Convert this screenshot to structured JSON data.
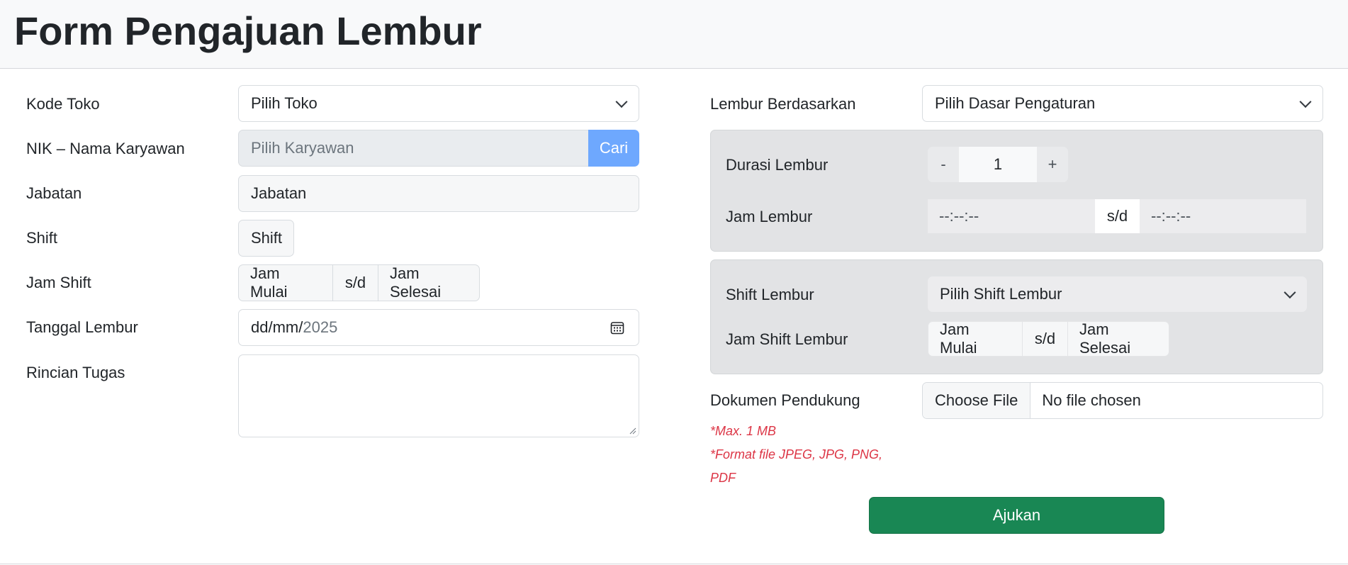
{
  "header": {
    "title": "Form Pengajuan Lembur"
  },
  "left": {
    "kode_toko": {
      "label": "Kode Toko",
      "value": "Pilih Toko"
    },
    "nik": {
      "label": "NIK – Nama Karyawan",
      "placeholder": "Pilih Karyawan",
      "button": "Cari"
    },
    "jabatan": {
      "label": "Jabatan",
      "value": "Jabatan"
    },
    "shift": {
      "label": "Shift",
      "value": "Shift"
    },
    "jam_shift": {
      "label": "Jam Shift",
      "start": "Jam Mulai",
      "sep": "s/d",
      "end": "Jam Selesai"
    },
    "tanggal": {
      "label": "Tanggal Lembur",
      "value_prefix": "dd/mm/",
      "value_year": "2025"
    },
    "rincian": {
      "label": "Rincian Tugas",
      "value": ""
    }
  },
  "right": {
    "lembur_berdasarkan": {
      "label": "Lembur Berdasarkan",
      "value": "Pilih Dasar Pengaturan"
    },
    "durasi": {
      "label": "Durasi Lembur",
      "minus": "-",
      "value": "1",
      "plus": "+"
    },
    "jam_lembur": {
      "label": "Jam Lembur",
      "start": "--:--:--",
      "sep": "s/d",
      "end": "--:--:--"
    },
    "shift_lembur": {
      "label": "Shift Lembur",
      "value": "Pilih Shift Lembur"
    },
    "jam_shift_lembur": {
      "label": "Jam Shift Lembur",
      "start": "Jam Mulai",
      "sep": "s/d",
      "end": "Jam Selesai"
    },
    "dokumen": {
      "label": "Dokumen Pendukung",
      "button": "Choose File",
      "status": "No file chosen"
    },
    "help": {
      "line1": "*Max. 1 MB",
      "line2": "*Format file JPEG, JPG, PNG,",
      "line3": "PDF"
    },
    "submit": "Ajukan"
  },
  "colors": {
    "accent": "#6ea8fe",
    "submit": "#198754",
    "help": "#dc3545",
    "panel": "#e2e3e5"
  }
}
